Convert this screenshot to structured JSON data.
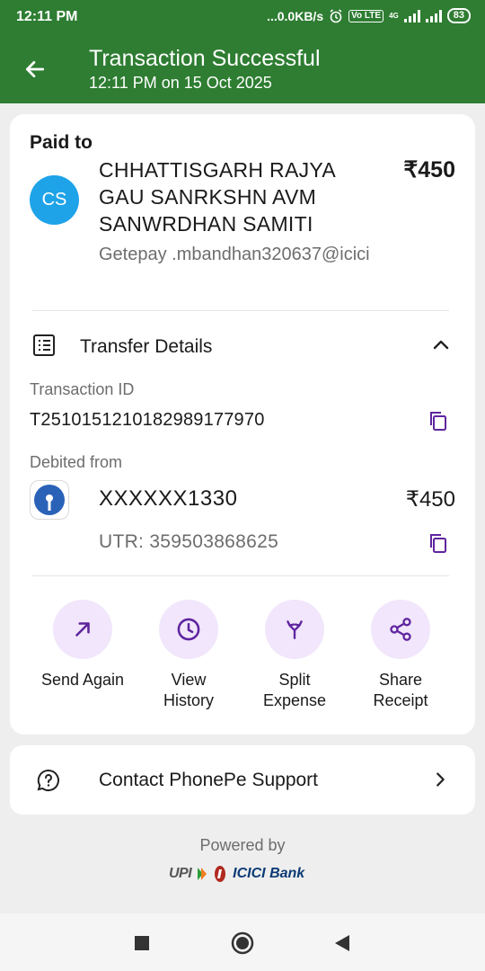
{
  "status_bar": {
    "time": "12:11 PM",
    "network_speed": "...0.0KB/s",
    "volte": "Vo LTE",
    "net_type": "4G",
    "battery": "83"
  },
  "header": {
    "title": "Transaction Successful",
    "subtitle": "12:11 PM on 15 Oct 2025",
    "bg_color": "#2e7d32"
  },
  "payment": {
    "paid_to_label": "Paid to",
    "avatar_initials": "CS",
    "payee_name": "CHHATTISGARH RAJYA GAU SANRKSHN AVM SANWRDHAN SAMITI",
    "payee_vpa": "Getepay .mbandhan320637@icici",
    "amount": "₹450"
  },
  "transfer_details": {
    "label": "Transfer Details",
    "transaction_id_label": "Transaction ID",
    "transaction_id": "T2510151210182989177970",
    "debited_from_label": "Debited from",
    "account_number": "XXXXXX1330",
    "debited_amount": "₹450",
    "utr": "UTR: 359503868625"
  },
  "actions": [
    {
      "label": "Send Again",
      "icon": "arrow-up-right-icon"
    },
    {
      "label": "View History",
      "icon": "clock-icon"
    },
    {
      "label": "Split Expense",
      "icon": "split-icon"
    },
    {
      "label": "Share Receipt",
      "icon": "share-icon"
    }
  ],
  "support": {
    "label": "Contact PhonePe Support"
  },
  "footer": {
    "powered_by": "Powered by",
    "upi_logo": "UPI",
    "bank_logo": "ICICI Bank"
  },
  "accent_color": "#5f259f"
}
